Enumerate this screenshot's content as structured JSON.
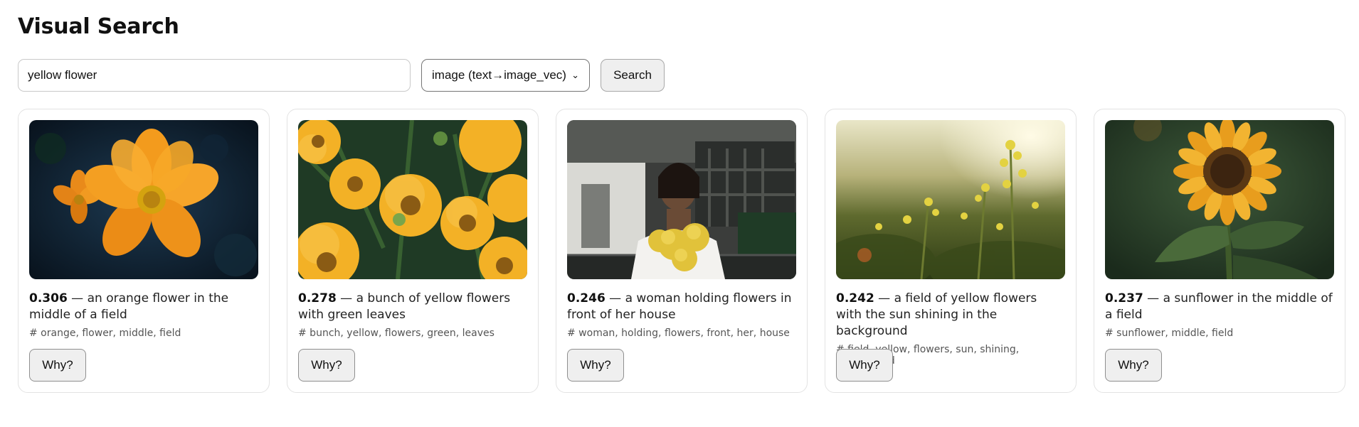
{
  "page": {
    "title": "Visual Search"
  },
  "search": {
    "query": "yellow flower",
    "mode_selected": "image (text→image_vec)",
    "search_label": "Search"
  },
  "results": [
    {
      "score": "0.306",
      "sep": " — ",
      "caption": "an orange flower in the middle of a field",
      "tags": "# orange, flower, middle, field",
      "why_label": "Why?",
      "image_name": "orange-flower-image"
    },
    {
      "score": "0.278",
      "sep": " — ",
      "caption": "a bunch of yellow flowers with green leaves",
      "tags": "# bunch, yellow, flowers, green, leaves",
      "why_label": "Why?",
      "image_name": "yellow-flowers-image"
    },
    {
      "score": "0.246",
      "sep": " — ",
      "caption": "a woman holding flowers in front of her house",
      "tags": "# woman, holding, flowers, front, her, house",
      "why_label": "Why?",
      "image_name": "woman-flowers-image"
    },
    {
      "score": "0.242",
      "sep": " — ",
      "caption": "a field of yellow flowers with the sun shining in the background",
      "tags": "# field, yellow, flowers, sun, shining, background",
      "why_label": "Why?",
      "image_name": "field-sun-image"
    },
    {
      "score": "0.237",
      "sep": " — ",
      "caption": "a sunflower in the middle of a field",
      "tags": "# sunflower, middle, field",
      "why_label": "Why?",
      "image_name": "sunflower-image"
    }
  ]
}
